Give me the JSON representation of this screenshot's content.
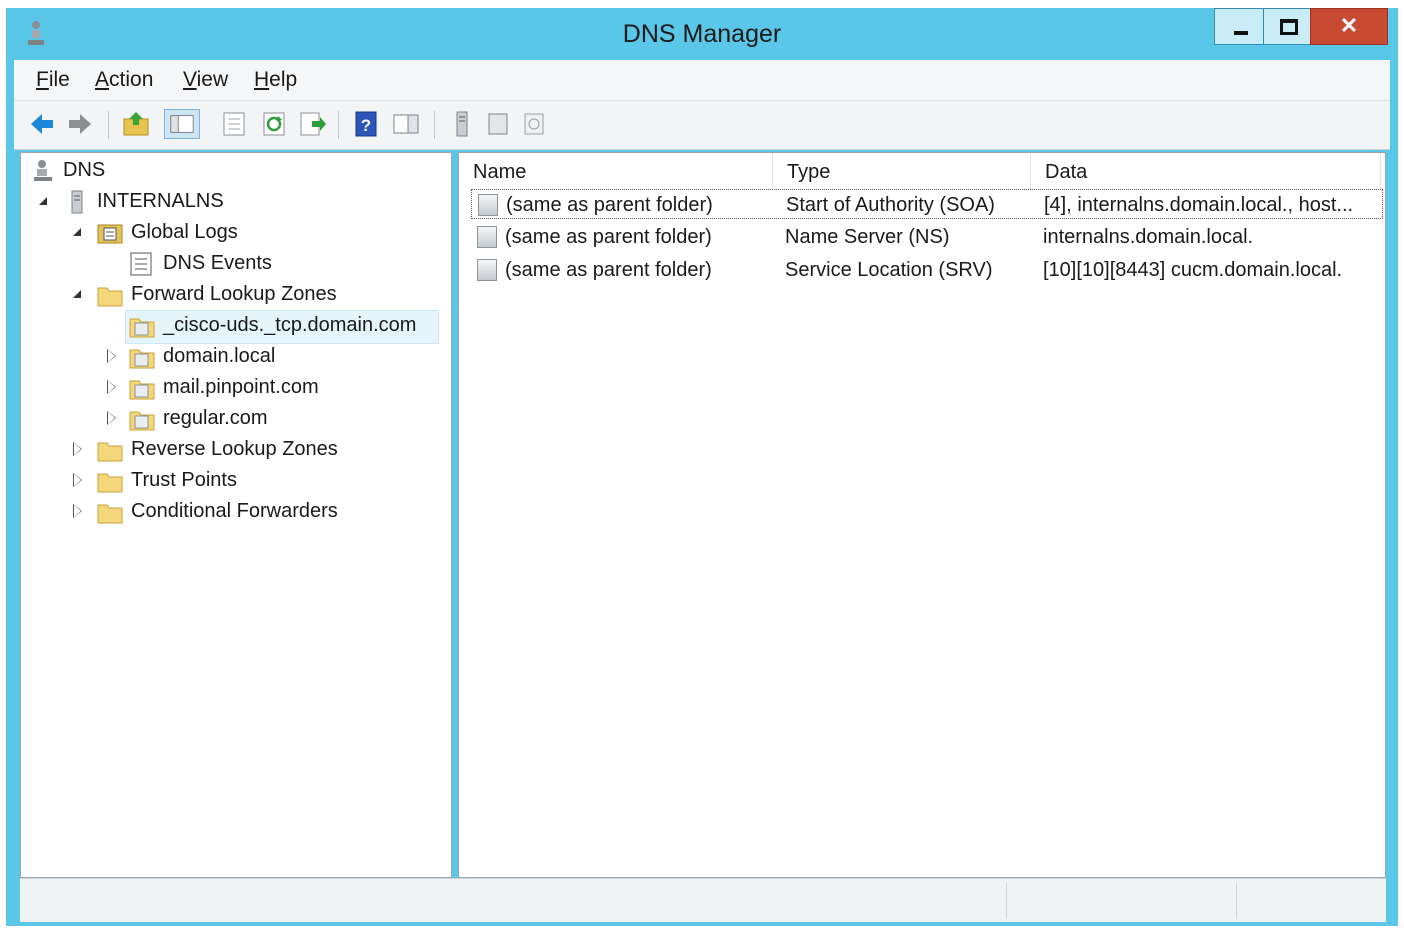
{
  "window": {
    "title": "DNS Manager"
  },
  "menu": {
    "file": "File",
    "action": "Action",
    "view": "View",
    "help": "Help"
  },
  "toolbar": {
    "icons": [
      "back-arrow-icon",
      "forward-arrow-icon",
      "up-folder-icon",
      "console-tree-icon",
      "properties-icon",
      "refresh-icon",
      "export-list-icon",
      "help-icon",
      "show-hide-icon",
      "server-icon",
      "record-icon",
      "zone-icon"
    ]
  },
  "tree": {
    "root": "DNS",
    "server": "INTERNALNS",
    "global_logs": "Global Logs",
    "dns_events": "DNS Events",
    "forward_lookup_zones": "Forward Lookup Zones",
    "zones": [
      "_cisco-uds._tcp.domain.com",
      "domain.local",
      "mail.pinpoint.com",
      "regular.com"
    ],
    "reverse_lookup_zones": "Reverse Lookup Zones",
    "trust_points": "Trust Points",
    "conditional_forwarders": "Conditional Forwarders"
  },
  "list": {
    "columns": [
      "Name",
      "Type",
      "Data"
    ],
    "rows": [
      {
        "name": "(same as parent folder)",
        "type": "Start of Authority (SOA)",
        "data": "[4], internalns.domain.local., host..."
      },
      {
        "name": "(same as parent folder)",
        "type": "Name Server (NS)",
        "data": "internalns.domain.local."
      },
      {
        "name": "(same as parent folder)",
        "type": "Service Location (SRV)",
        "data": "[10][10][8443] cucm.domain.local."
      }
    ]
  },
  "colors": {
    "frame": "#5ac7e8",
    "close": "#c84a33",
    "selection": "#e5f3fb"
  }
}
